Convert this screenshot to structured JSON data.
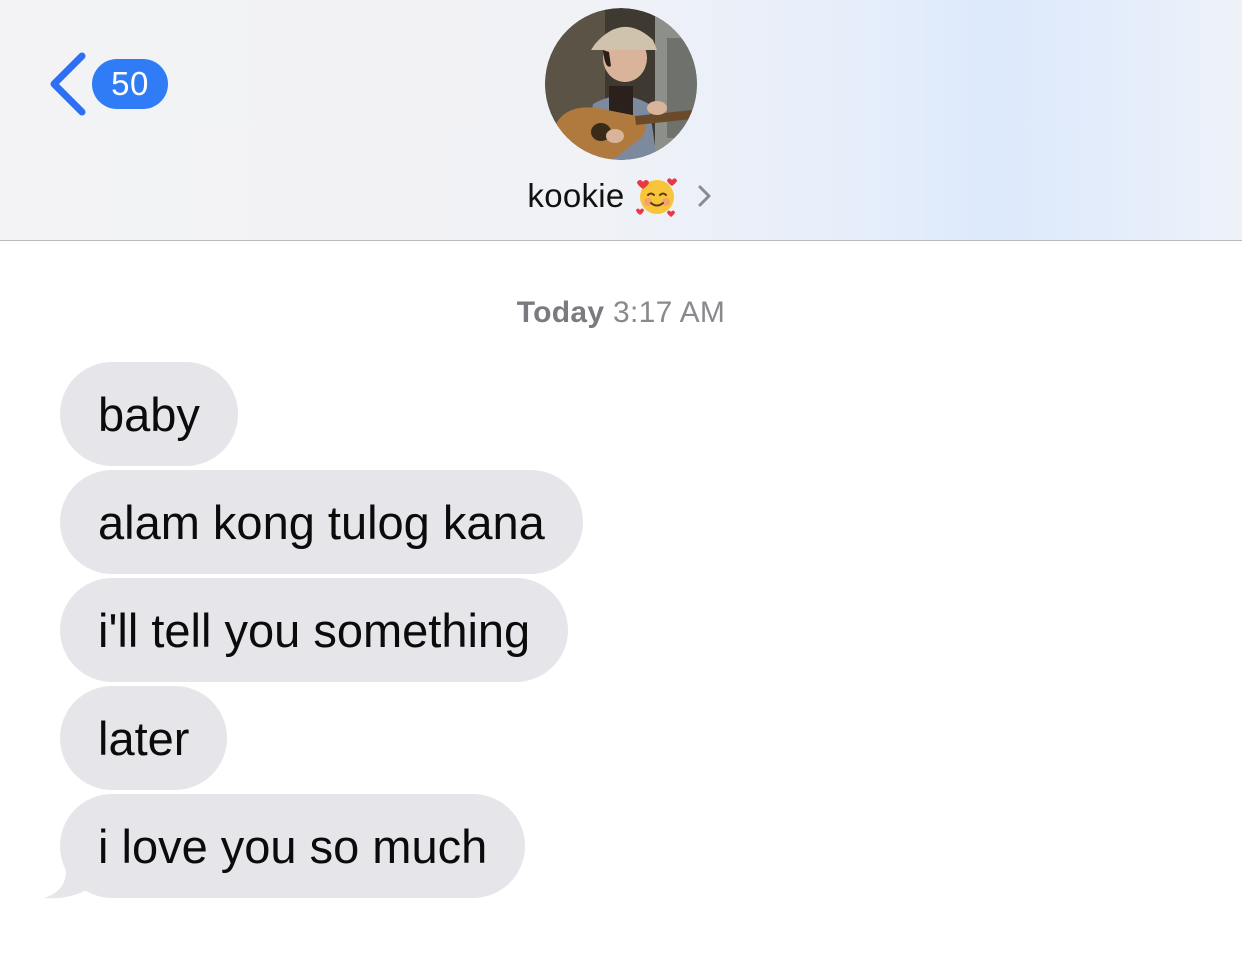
{
  "header": {
    "back_count": "50",
    "contact_name": "kookie",
    "contact_emoji": "smiling-face-with-hearts-emoji",
    "accent_color": "#2f7cf6"
  },
  "conversation": {
    "timestamp_day": "Today",
    "timestamp_time": "3:17 AM",
    "messages": [
      {
        "text": "baby",
        "direction": "received"
      },
      {
        "text": "alam kong tulog kana",
        "direction": "received"
      },
      {
        "text": "i'll tell you something",
        "direction": "received"
      },
      {
        "text": "later",
        "direction": "received"
      },
      {
        "text": "i love you so much",
        "direction": "received"
      }
    ],
    "bubble_color": "#e5e5ea"
  }
}
